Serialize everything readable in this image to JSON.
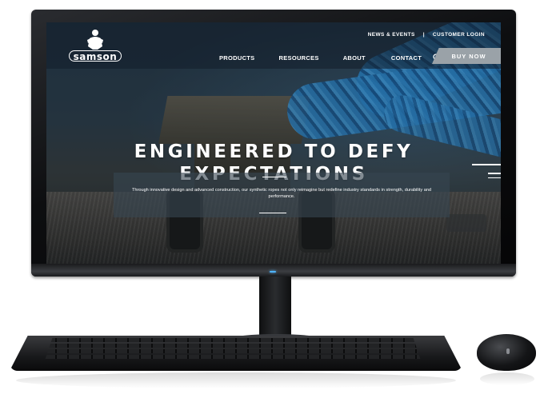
{
  "header": {
    "logo_text": "samson",
    "util_nav": {
      "news_events": "NEWS & EVENTS",
      "separator": "|",
      "customer_login": "CUSTOMER LOGIN"
    },
    "main_nav": {
      "products": "PRODUCTS",
      "resources": "RESOURCES",
      "about": "ABOUT",
      "contact": "CONTACT"
    },
    "search_icon": "search-icon",
    "buy_now": "BUY NOW"
  },
  "hero": {
    "title": "ENGINEERED TO DEFY EXPECTATIONS",
    "subtitle": "Through innovative design and advanced construction, our synthetic ropes not only reimagine but redefine industry standards in strength, durability and performance."
  },
  "colors": {
    "rope_blue": "#2f8fd8",
    "buy_now_bg": "#9aa2a8",
    "power_led": "#4fb4ff"
  }
}
